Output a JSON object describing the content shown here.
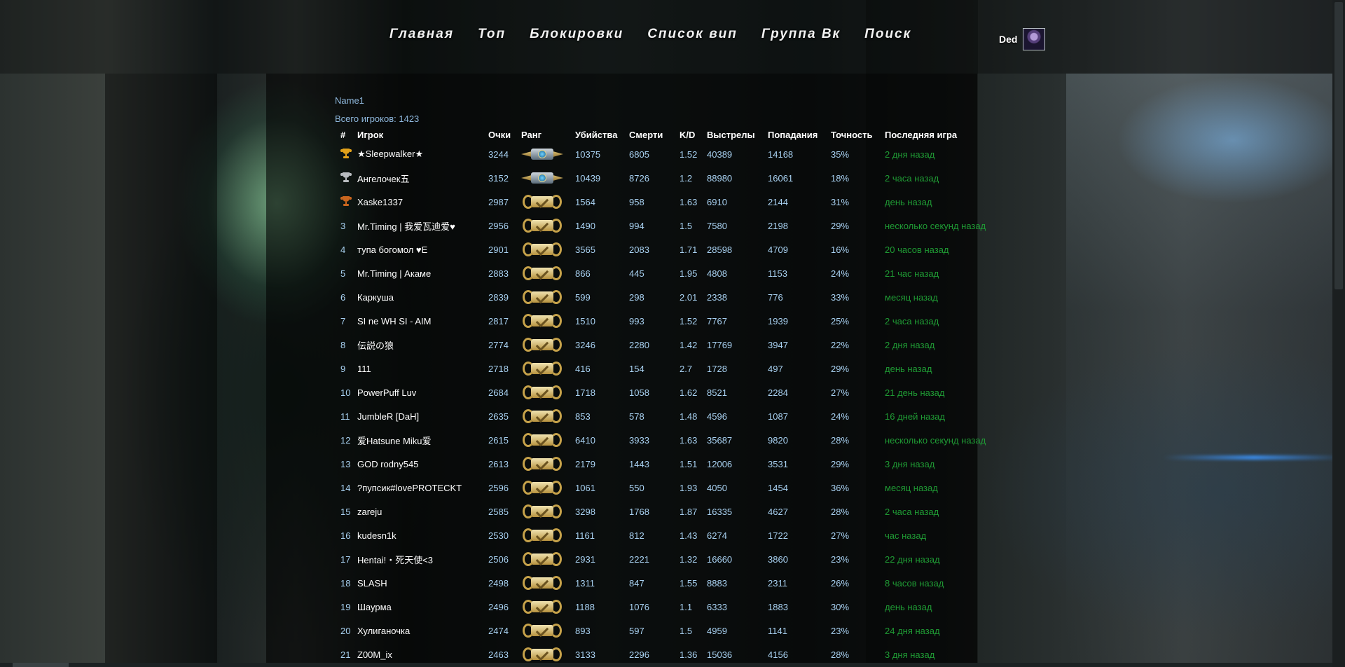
{
  "nav": {
    "items": [
      "Главная",
      "Топ",
      "Блокировки",
      "Список вип",
      "Группа Вк",
      "Поиск"
    ]
  },
  "user": {
    "name": "Ded"
  },
  "server": {
    "name": "Name1",
    "total_label": "Всего игроков: 1423"
  },
  "table": {
    "headers": [
      "#",
      "Игрок",
      "Очки",
      "Ранг",
      "Убийства",
      "Смерти",
      "K/D",
      "Выстрелы",
      "Попадания",
      "Точность",
      "Последняя игра"
    ],
    "rows": [
      {
        "place": "",
        "trophy": "gold",
        "name": "★Sleepwalker★",
        "points": "3244",
        "rank": "global-elite",
        "kills": "10375",
        "deaths": "6805",
        "kd": "1.52",
        "shots": "40389",
        "hits": "14168",
        "accuracy": "35%",
        "last": "2 дня назад"
      },
      {
        "place": "",
        "trophy": "silver",
        "name": "Ангелочек五",
        "points": "3152",
        "rank": "global-elite",
        "kills": "10439",
        "deaths": "8726",
        "kd": "1.2",
        "shots": "88980",
        "hits": "16061",
        "accuracy": "18%",
        "last": "2 часа назад"
      },
      {
        "place": "",
        "trophy": "bronze",
        "name": "Xaske1337",
        "points": "2987",
        "rank": "gold-wreath",
        "kills": "1564",
        "deaths": "958",
        "kd": "1.63",
        "shots": "6910",
        "hits": "2144",
        "accuracy": "31%",
        "last": "день назад"
      },
      {
        "place": "3",
        "trophy": "",
        "name": "Mr.Timing | 我爱瓦迪爱♥",
        "points": "2956",
        "rank": "gold-wreath",
        "kills": "1490",
        "deaths": "994",
        "kd": "1.5",
        "shots": "7580",
        "hits": "2198",
        "accuracy": "29%",
        "last": "несколько секунд назад"
      },
      {
        "place": "4",
        "trophy": "",
        "name": "тупа богомол ♥Е",
        "points": "2901",
        "rank": "gold-wreath",
        "kills": "3565",
        "deaths": "2083",
        "kd": "1.71",
        "shots": "28598",
        "hits": "4709",
        "accuracy": "16%",
        "last": "20 часов назад"
      },
      {
        "place": "5",
        "trophy": "",
        "name": "Mr.Timing | Акаме",
        "points": "2883",
        "rank": "gold-wreath",
        "kills": "866",
        "deaths": "445",
        "kd": "1.95",
        "shots": "4808",
        "hits": "1153",
        "accuracy": "24%",
        "last": "21 час назад"
      },
      {
        "place": "6",
        "trophy": "",
        "name": "Каркуша",
        "points": "2839",
        "rank": "gold-wreath",
        "kills": "599",
        "deaths": "298",
        "kd": "2.01",
        "shots": "2338",
        "hits": "776",
        "accuracy": "33%",
        "last": "месяц назад"
      },
      {
        "place": "7",
        "trophy": "",
        "name": "SI ne WH SI - AIM",
        "points": "2817",
        "rank": "gold-wreath",
        "kills": "1510",
        "deaths": "993",
        "kd": "1.52",
        "shots": "7767",
        "hits": "1939",
        "accuracy": "25%",
        "last": "2 часа назад"
      },
      {
        "place": "8",
        "trophy": "",
        "name": "伝説の狼",
        "points": "2774",
        "rank": "gold-wreath",
        "kills": "3246",
        "deaths": "2280",
        "kd": "1.42",
        "shots": "17769",
        "hits": "3947",
        "accuracy": "22%",
        "last": "2 дня назад"
      },
      {
        "place": "9",
        "trophy": "",
        "name": "111",
        "points": "2718",
        "rank": "gold-wreath",
        "kills": "416",
        "deaths": "154",
        "kd": "2.7",
        "shots": "1728",
        "hits": "497",
        "accuracy": "29%",
        "last": "день назад"
      },
      {
        "place": "10",
        "trophy": "",
        "name": "PowerPuff Luv",
        "points": "2684",
        "rank": "gold-wreath",
        "kills": "1718",
        "deaths": "1058",
        "kd": "1.62",
        "shots": "8521",
        "hits": "2284",
        "accuracy": "27%",
        "last": "21 день назад"
      },
      {
        "place": "11",
        "trophy": "",
        "name": "JumbleR [DaH]",
        "points": "2635",
        "rank": "gold-wreath",
        "kills": "853",
        "deaths": "578",
        "kd": "1.48",
        "shots": "4596",
        "hits": "1087",
        "accuracy": "24%",
        "last": "16 дней назад"
      },
      {
        "place": "12",
        "trophy": "",
        "name": "爱Hatsune Miku爱",
        "points": "2615",
        "rank": "gold-wreath",
        "kills": "6410",
        "deaths": "3933",
        "kd": "1.63",
        "shots": "35687",
        "hits": "9820",
        "accuracy": "28%",
        "last": "несколько секунд назад"
      },
      {
        "place": "13",
        "trophy": "",
        "name": "GOD rodny545",
        "points": "2613",
        "rank": "gold-wreath",
        "kills": "2179",
        "deaths": "1443",
        "kd": "1.51",
        "shots": "12006",
        "hits": "3531",
        "accuracy": "29%",
        "last": "3 дня назад"
      },
      {
        "place": "14",
        "trophy": "",
        "name": "?пупсик#lovePROTECKT",
        "points": "2596",
        "rank": "gold-wreath",
        "kills": "1061",
        "deaths": "550",
        "kd": "1.93",
        "shots": "4050",
        "hits": "1454",
        "accuracy": "36%",
        "last": "месяц назад"
      },
      {
        "place": "15",
        "trophy": "",
        "name": "zareju",
        "points": "2585",
        "rank": "gold-wreath",
        "kills": "3298",
        "deaths": "1768",
        "kd": "1.87",
        "shots": "16335",
        "hits": "4627",
        "accuracy": "28%",
        "last": "2 часа назад"
      },
      {
        "place": "16",
        "trophy": "",
        "name": "kudesn1k",
        "points": "2530",
        "rank": "gold-wreath",
        "kills": "1161",
        "deaths": "812",
        "kd": "1.43",
        "shots": "6274",
        "hits": "1722",
        "accuracy": "27%",
        "last": "час назад"
      },
      {
        "place": "17",
        "trophy": "",
        "name": "Hentai!・死天使<3",
        "points": "2506",
        "rank": "gold-wreath",
        "kills": "2931",
        "deaths": "2221",
        "kd": "1.32",
        "shots": "16660",
        "hits": "3860",
        "accuracy": "23%",
        "last": "22 дня назад"
      },
      {
        "place": "18",
        "trophy": "",
        "name": "SLASH",
        "points": "2498",
        "rank": "gold-wreath",
        "kills": "1311",
        "deaths": "847",
        "kd": "1.55",
        "shots": "8883",
        "hits": "2311",
        "accuracy": "26%",
        "last": "8 часов назад"
      },
      {
        "place": "19",
        "trophy": "",
        "name": "Шаурма",
        "points": "2496",
        "rank": "gold-wreath",
        "kills": "1188",
        "deaths": "1076",
        "kd": "1.1",
        "shots": "6333",
        "hits": "1883",
        "accuracy": "30%",
        "last": "день назад"
      },
      {
        "place": "20",
        "trophy": "",
        "name": "Хулиганочка",
        "points": "2474",
        "rank": "gold-wreath",
        "kills": "893",
        "deaths": "597",
        "kd": "1.5",
        "shots": "4959",
        "hits": "1141",
        "accuracy": "23%",
        "last": "24 дня назад"
      },
      {
        "place": "21",
        "trophy": "",
        "name": "Z00M_ix",
        "points": "2463",
        "rank": "gold-wreath",
        "kills": "3133",
        "deaths": "2296",
        "kd": "1.36",
        "shots": "15036",
        "hits": "4156",
        "accuracy": "28%",
        "last": "3 дня назад"
      }
    ]
  },
  "colors": {
    "accent_text": "#a9d2f2",
    "last_game": "#1f9b34",
    "gold": "#e3a21a",
    "silver": "#b8bcc0",
    "bronze": "#c8651e"
  }
}
